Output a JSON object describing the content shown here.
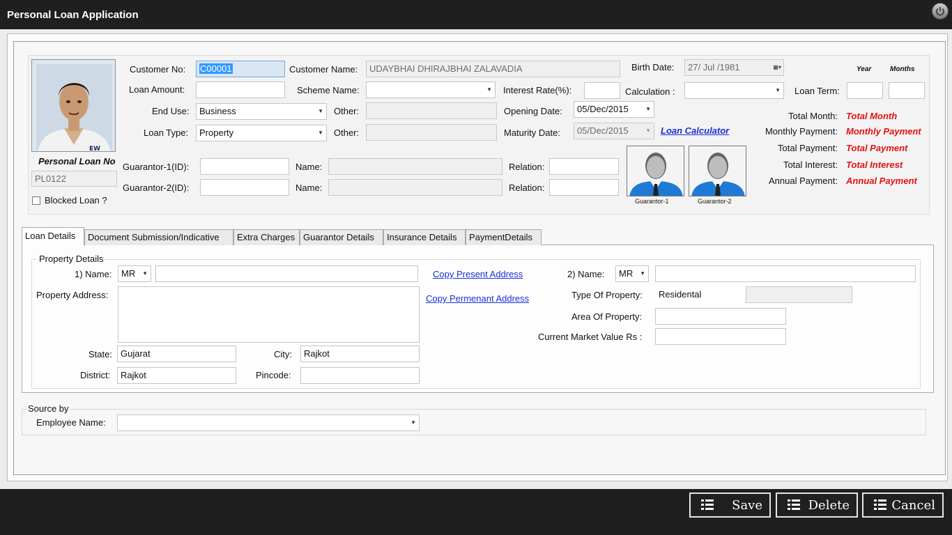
{
  "window": {
    "title": "Personal Loan Application"
  },
  "header": {
    "personal_loan_no_label": "Personal Loan No",
    "personal_loan_no_value": "PL0122",
    "blocked_loan_label": "Blocked Loan ?",
    "customer_no_label": "Customer No:",
    "customer_no_value": "C00001",
    "customer_name_label": "Customer Name:",
    "customer_name_value": "UDAYBHAI DHIRAJBHAI ZALAVADIA",
    "birth_date_label": "Birth Date:",
    "birth_date_value": "27/ Jul /1981",
    "loan_amount_label": "Loan Amount:",
    "scheme_name_label": "Scheme Name:",
    "interest_rate_label": "Interest Rate(%):",
    "calculation_label": "Calculation :",
    "loan_term_label": "Loan Term:",
    "year_label": "Year",
    "months_label": "Months",
    "end_use_label": "End Use:",
    "end_use_value": "Business",
    "other_label_1": "Other:",
    "opening_date_label": "Opening Date:",
    "opening_date_value": "05/Dec/2015",
    "loan_type_label": "Loan Type:",
    "loan_type_value": "Property",
    "other_label_2": "Other:",
    "maturity_date_label": "Maturity Date:",
    "maturity_date_value": "05/Dec/2015",
    "loan_calculator_link": "Loan Calculator",
    "guarantor1_id_label": "Guarantor-1(ID):",
    "guarantor2_id_label": "Guarantor-2(ID):",
    "name_label_1": "Name:",
    "name_label_2": "Name:",
    "relation_label_1": "Relation:",
    "relation_label_2": "Relation:",
    "guarantor1_caption": "Guarantor-1",
    "guarantor2_caption": "Guarantor-2"
  },
  "summary": {
    "total_month_label": "Total Month:",
    "total_month_value": "Total Month",
    "monthly_payment_label": "Monthly Payment:",
    "monthly_payment_value": "Monthly Payment",
    "total_payment_label": "Total Payment:",
    "total_payment_value": "Total Payment",
    "total_interest_label": "Total Interest:",
    "total_interest_value": "Total Interest",
    "annual_payment_label": "Annual Payment:",
    "annual_payment_value": "Annual Payment"
  },
  "tabs": [
    {
      "label": "Loan Details"
    },
    {
      "label": "Document Submission/Indicative"
    },
    {
      "label": "Extra Charges"
    },
    {
      "label": "Guarantor Details"
    },
    {
      "label": "Insurance Details"
    },
    {
      "label": "PaymentDetails"
    }
  ],
  "property": {
    "group_title": "Property Details",
    "name1_label": "1) Name:",
    "name1_title": "MR",
    "copy_present_link": "Copy Present Address",
    "copy_permanent_link": "Copy Permenant Address",
    "name2_label": "2) Name:",
    "name2_title": "MR",
    "address_label": "Property Address:",
    "type_label": "Type Of Property:",
    "type_value": "Residental",
    "area_label": "Area Of Property:",
    "market_value_label": "Current Market Value Rs :",
    "state_label": "State:",
    "state_value": "Gujarat",
    "city_label": "City:",
    "city_value": "Rajkot",
    "district_label": "District:",
    "district_value": "Rajkot",
    "pincode_label": "Pincode:"
  },
  "source": {
    "group_title": "Source by",
    "employee_name_label": "Employee Name:"
  },
  "footer": {
    "save_label": "Save",
    "delete_label": "Delete",
    "cancel_label": "Cancel"
  },
  "colors": {
    "accent_red": "#e31111",
    "link_blue": "#1a2fd6",
    "titlebar": "#1f1f1f"
  }
}
